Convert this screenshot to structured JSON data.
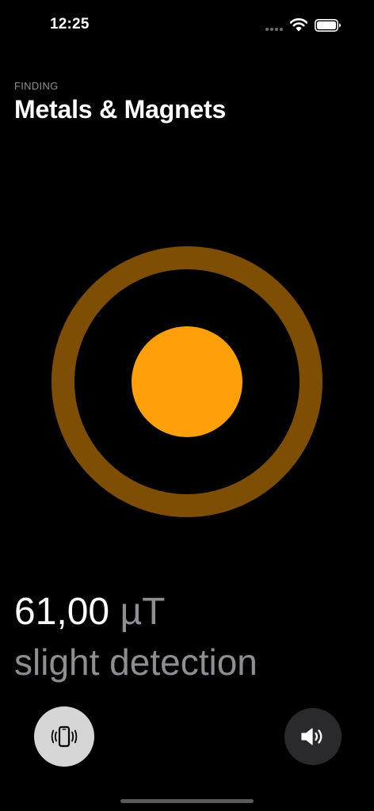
{
  "status_bar": {
    "time": "12:25",
    "icons": [
      "cellular-icon",
      "wifi-icon",
      "battery-icon"
    ]
  },
  "header": {
    "eyebrow": "FINDING",
    "title": "Metals & Magnets"
  },
  "detector": {
    "ring_color": "#7f4e05",
    "core_color": "#ff9f0a"
  },
  "reading": {
    "value": "61,00",
    "unit": "µT",
    "status": "slight detection"
  },
  "controls": {
    "vibrate_icon": "phone-vibrate-icon",
    "sound_icon": "speaker-icon"
  },
  "colors": {
    "background": "#000000",
    "accent": "#ff9f0a",
    "secondary_text": "#8e8e93"
  }
}
